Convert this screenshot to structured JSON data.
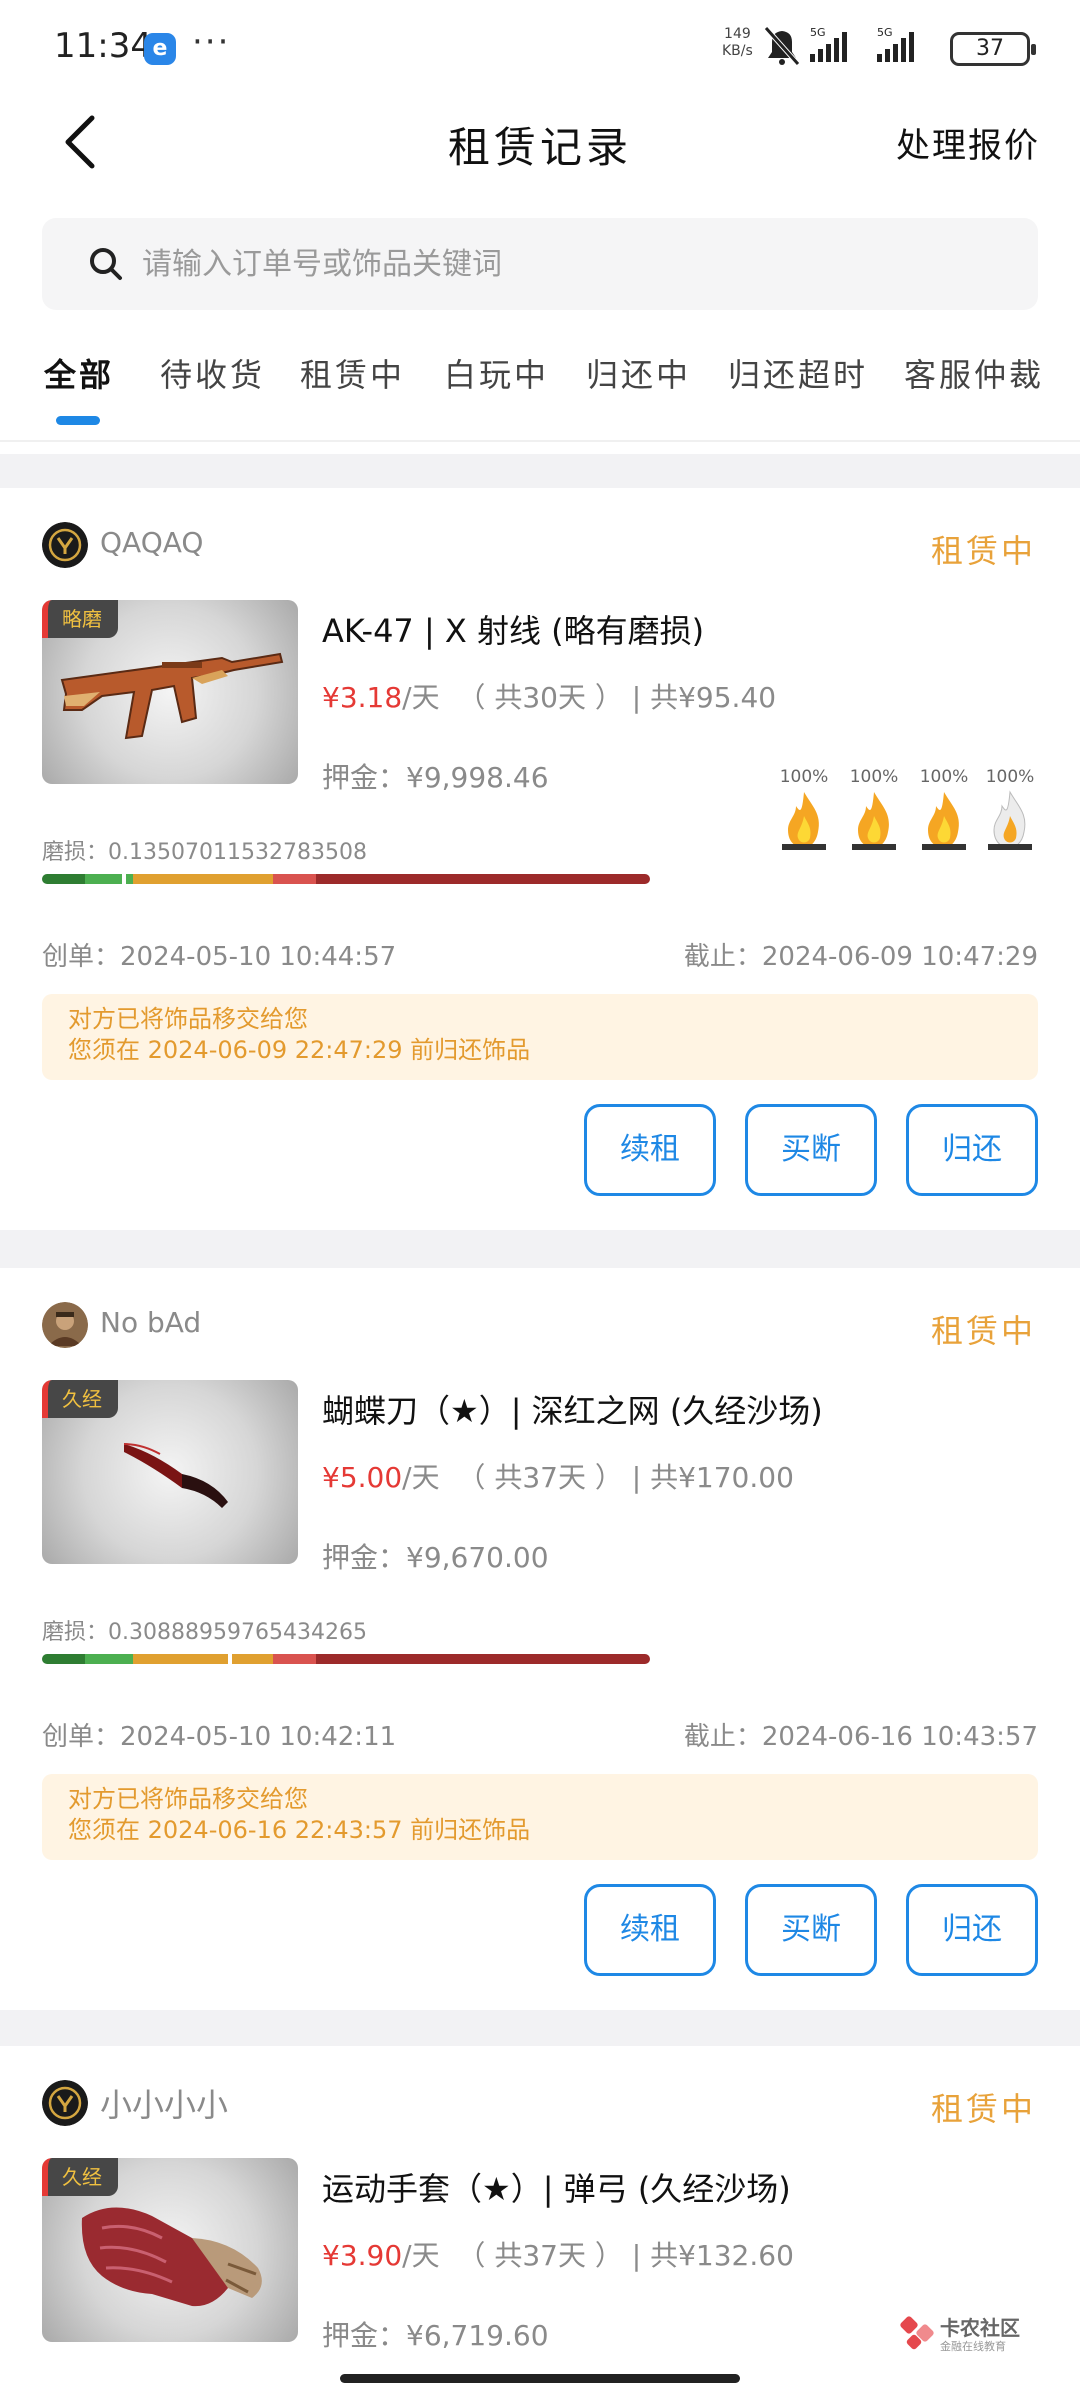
{
  "status_bar": {
    "time": "11:34",
    "network_speed": "149\nKB/s",
    "battery": "37"
  },
  "header": {
    "title": "租赁记录",
    "action": "处理报价"
  },
  "search": {
    "placeholder": "请输入订单号或饰品关键词"
  },
  "tabs": [
    "全部",
    "待收货",
    "租赁中",
    "白玩中",
    "归还中",
    "归还超时",
    "客服仲裁"
  ],
  "active_tab": "全部",
  "orders": [
    {
      "seller": "QAQAQ",
      "status": "租赁中",
      "wear_badge": "略磨",
      "item_name": "AK-47 | X 射线 (略有磨损)",
      "daily_price": "¥3.18",
      "per_day": "/天",
      "days": "（ 共30天 ）",
      "total": "| 共¥95.40",
      "deposit_label": "押金：",
      "deposit": "¥9,998.46",
      "wear_label": "磨损：",
      "wear_value": "0.13507011532783508",
      "wear_float": 0.13507011532783508,
      "flames": [
        "100%",
        "100%",
        "100%",
        "100%"
      ],
      "created_label": "创单：",
      "created": "2024-05-10 10:44:57",
      "deadline_label": "截止：",
      "deadline": "2024-06-09 10:47:29",
      "notice_1": "对方已将饰品移交给您",
      "notice_2": "您须在 2024-06-09 22:47:29 前归还饰品",
      "btn_renew": "续租",
      "btn_buy": "买断",
      "btn_return": "归还"
    },
    {
      "seller": "No bAd",
      "status": "租赁中",
      "wear_badge": "久经",
      "item_name": "蝴蝶刀（★）| 深红之网 (久经沙场)",
      "daily_price": "¥5.00",
      "per_day": "/天",
      "days": "（ 共37天 ）",
      "total": "| 共¥170.00",
      "deposit_label": "押金：",
      "deposit": "¥9,670.00",
      "wear_label": "磨损：",
      "wear_value": "0.30888959765434265",
      "wear_float": 0.30888959765434265,
      "flames": [],
      "created_label": "创单：",
      "created": "2024-05-10 10:42:11",
      "deadline_label": "截止：",
      "deadline": "2024-06-16 10:43:57",
      "notice_1": "对方已将饰品移交给您",
      "notice_2": "您须在 2024-06-16 22:43:57 前归还饰品",
      "btn_renew": "续租",
      "btn_buy": "买断",
      "btn_return": "归还"
    },
    {
      "seller": "小小小小",
      "status": "租赁中",
      "wear_badge": "久经",
      "item_name": "运动手套（★）| 弹弓 (久经沙场)",
      "daily_price": "¥3.90",
      "per_day": "/天",
      "days": "（ 共37天 ）",
      "total": "| 共¥132.60",
      "deposit_label": "押金：",
      "deposit": "¥6,719.60"
    }
  ],
  "watermark": {
    "name": "卡农社区",
    "subtitle": "金融在线教育"
  },
  "colors": {
    "accent_blue": "#1e88e5",
    "status_orange": "#e8a23a",
    "price_red": "#e53935",
    "notice_bg": "#fff4e3"
  },
  "icons": [
    "back-arrow-icon",
    "search-icon",
    "flame-icon",
    "bell-muted-icon",
    "signal-icon",
    "battery-icon"
  ]
}
